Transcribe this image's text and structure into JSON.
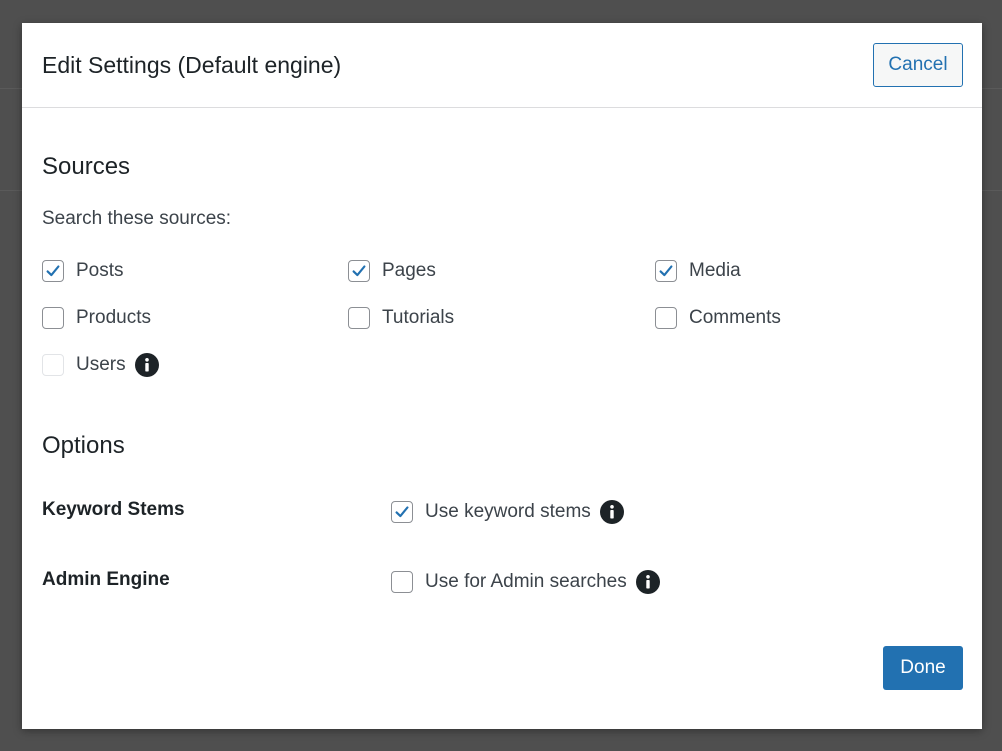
{
  "modal": {
    "title": "Edit Settings (Default engine)",
    "cancel_label": "Cancel",
    "done_label": "Done"
  },
  "sources": {
    "heading": "Sources",
    "subheading": "Search these sources:",
    "items": [
      {
        "label": "Posts",
        "checked": true
      },
      {
        "label": "Pages",
        "checked": true
      },
      {
        "label": "Media",
        "checked": true
      },
      {
        "label": "Products",
        "checked": false
      },
      {
        "label": "Tutorials",
        "checked": false
      },
      {
        "label": "Comments",
        "checked": false
      },
      {
        "label": "Users",
        "checked": false,
        "disabled": true,
        "info_icon": "info-icon"
      }
    ]
  },
  "options": {
    "heading": "Options",
    "rows": [
      {
        "label": "Keyword Stems",
        "checkbox_label": "Use keyword stems",
        "checked": true,
        "info_icon": "info-icon"
      },
      {
        "label": "Admin Engine",
        "checkbox_label": "Use for Admin searches",
        "checked": false,
        "info_icon": "info-icon"
      }
    ]
  },
  "colors": {
    "accent": "#2271b1",
    "overlay": "#4f4f4f",
    "text": "#1d2327"
  }
}
